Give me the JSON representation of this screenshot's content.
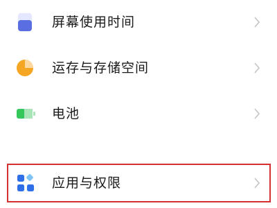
{
  "settings": {
    "items": [
      {
        "label": "屏幕使用时间",
        "icon": "screen-time-icon"
      },
      {
        "label": "运存与存储空间",
        "icon": "storage-pie-icon"
      },
      {
        "label": "电池",
        "icon": "battery-icon"
      },
      {
        "label": "应用与权限",
        "icon": "apps-grid-icon",
        "highlighted": true
      }
    ]
  },
  "colors": {
    "screen_time": "#5b6ee1",
    "storage": "#f5a623",
    "battery": "#34c759",
    "apps": "#2f6fe8",
    "highlight_border": "#d62f2f",
    "chevron": "#c4c4c4"
  }
}
